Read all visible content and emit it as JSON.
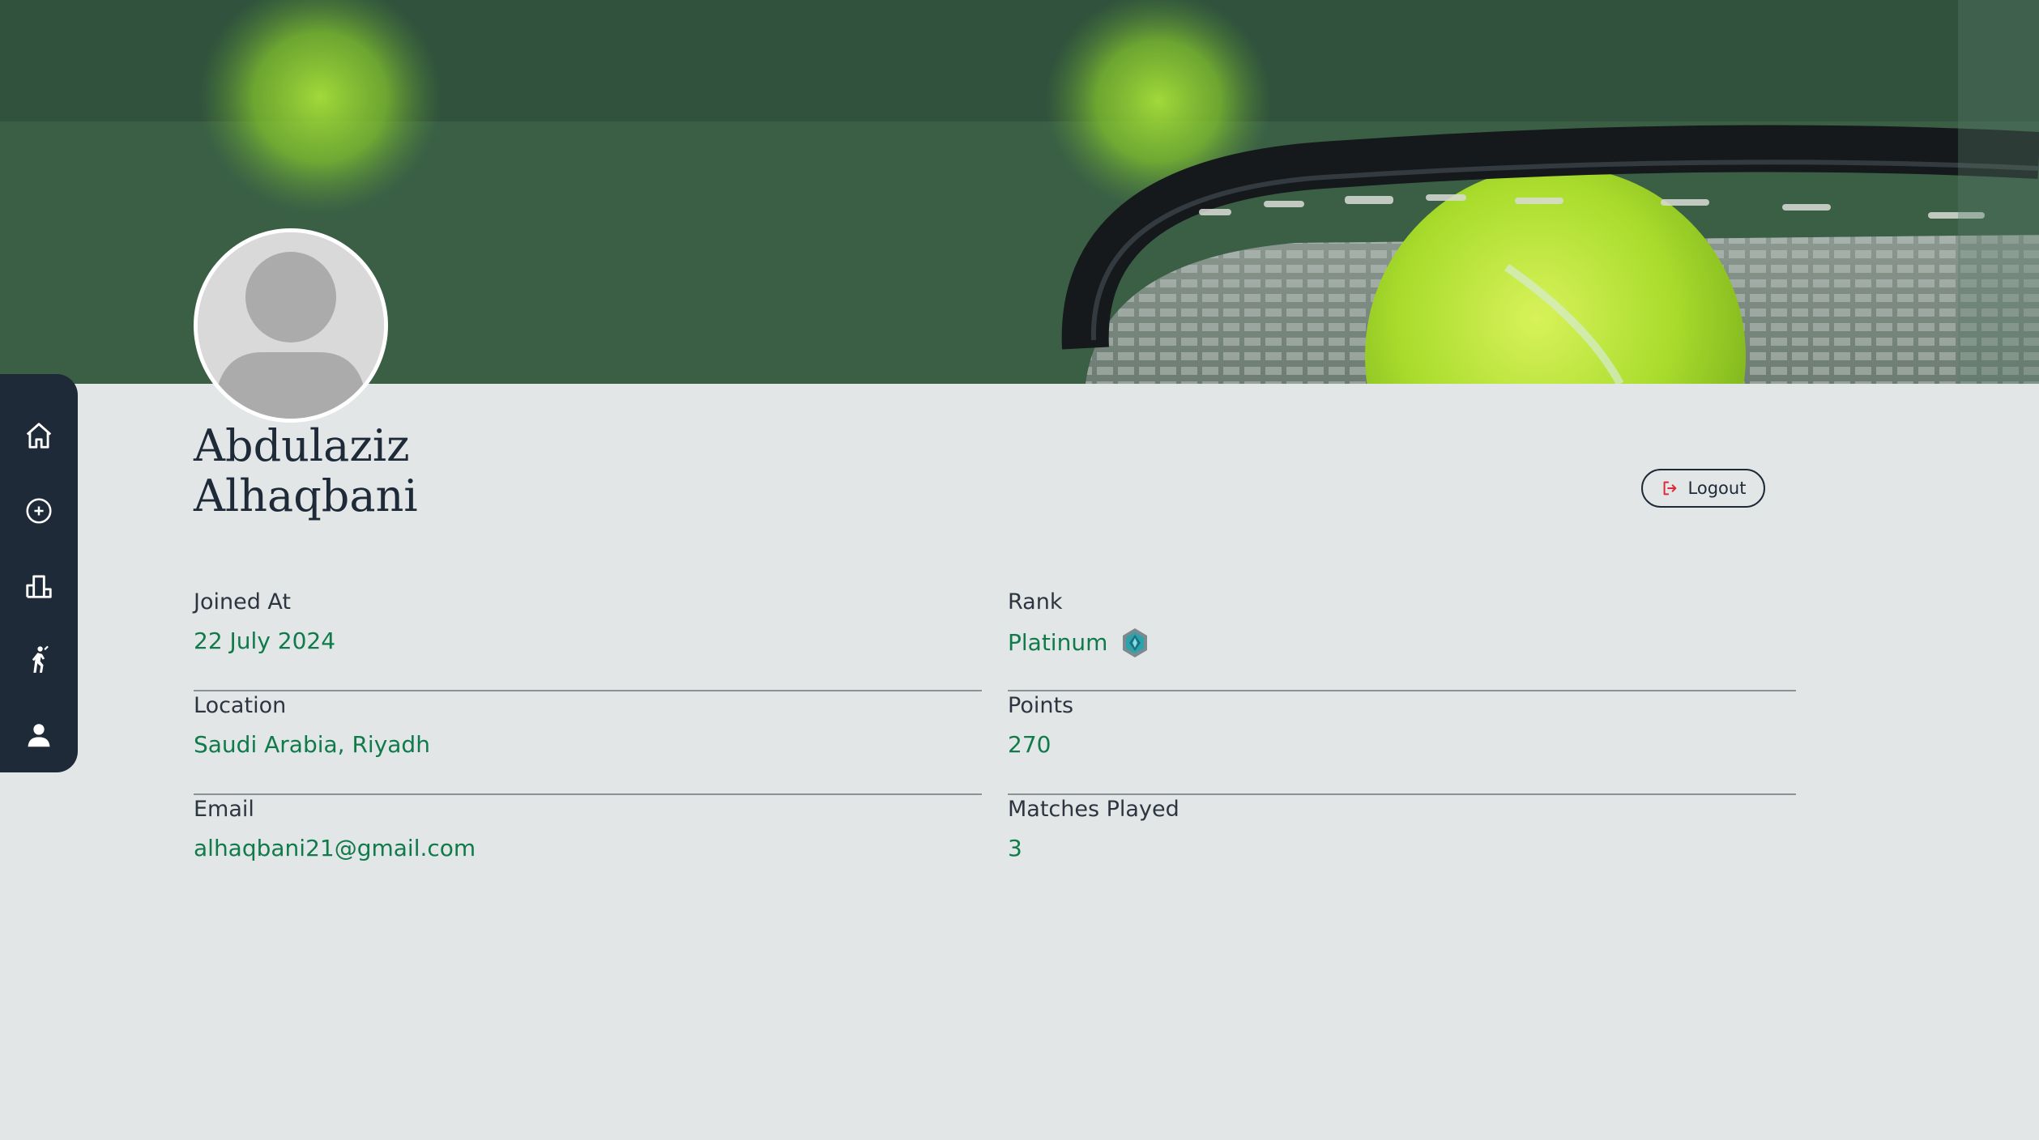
{
  "sidebar": {
    "items": [
      {
        "icon": "home-icon"
      },
      {
        "icon": "add-circle-icon"
      },
      {
        "icon": "leaderboard-icon"
      },
      {
        "icon": "player-icon"
      },
      {
        "icon": "profile-icon"
      }
    ]
  },
  "profile": {
    "first_name": "Abdulaziz",
    "last_name": "Alhaqbani",
    "logout_label": "Logout"
  },
  "info": {
    "joined": {
      "label": "Joined At",
      "value": "22 July 2024"
    },
    "location": {
      "label": "Location",
      "value": "Saudi Arabia, Riyadh"
    },
    "email": {
      "label": "Email",
      "value": "alhaqbani21@gmail.com"
    },
    "rank": {
      "label": "Rank",
      "value": "Platinum",
      "icon": "platinum-badge-icon"
    },
    "points": {
      "label": "Points",
      "value": "270"
    },
    "matches": {
      "label": "Matches Played",
      "value": "3"
    }
  },
  "colors": {
    "sidebar_bg": "#1e2a38",
    "page_bg": "#e2e6e7",
    "value_text": "#0f7a4a",
    "logout_icon": "#e0283a"
  }
}
